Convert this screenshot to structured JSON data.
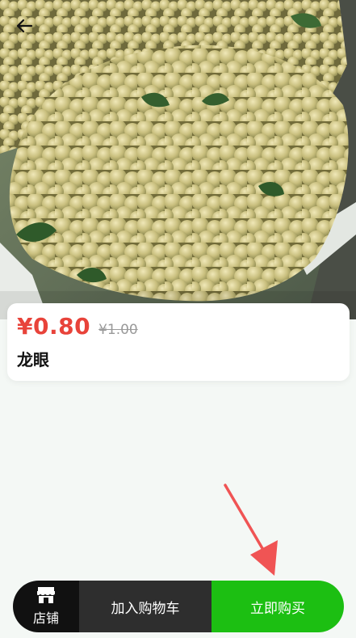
{
  "header": {
    "back_icon": "arrow-left-icon"
  },
  "product": {
    "image_alt": "longan fruit pile",
    "price_current": "¥0.80",
    "price_original": "¥1.00",
    "name": "龙眼"
  },
  "bottom_bar": {
    "shop_label": "店铺",
    "shop_icon": "store-icon",
    "add_to_cart_label": "加入购物车",
    "buy_now_label": "立即购买"
  },
  "colors": {
    "price_red": "#e8433a",
    "buy_green": "#1cbf12",
    "cart_dark": "#2e2e2e",
    "shop_black": "#111111",
    "annotation_red": "#f05454"
  }
}
